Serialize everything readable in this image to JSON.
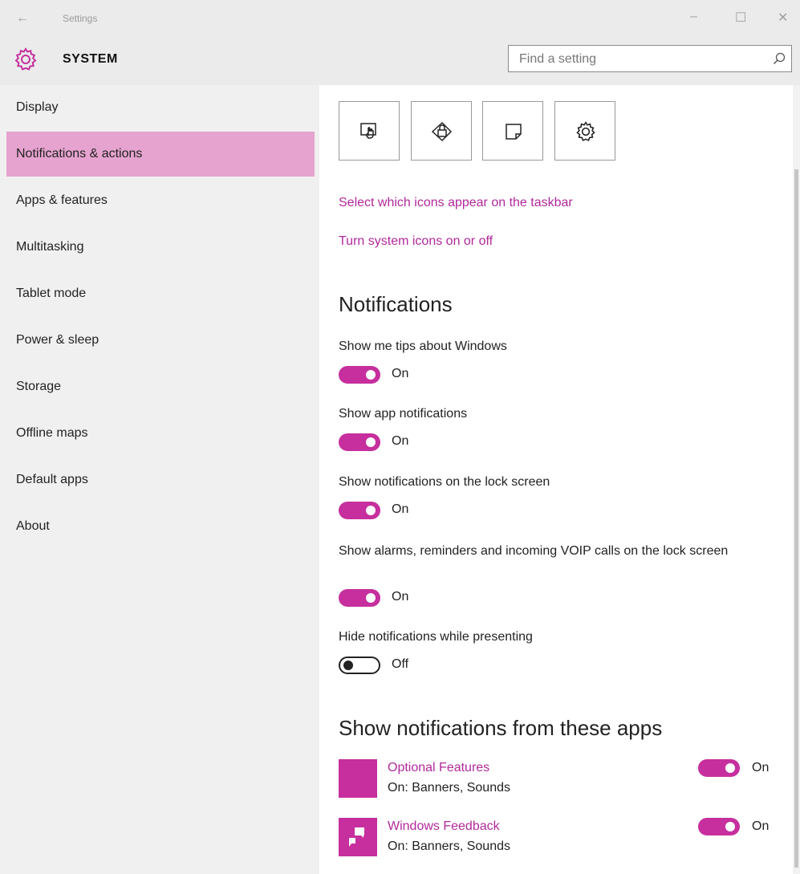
{
  "window": {
    "title": "Settings",
    "back_icon": "←",
    "minimize_icon": "–",
    "maximize_icon": "☐",
    "close_icon": "✕"
  },
  "header": {
    "title": "SYSTEM",
    "search_placeholder": "Find a setting"
  },
  "sidebar": {
    "items": [
      {
        "label": "Display"
      },
      {
        "label": "Notifications & actions",
        "selected": true
      },
      {
        "label": "Apps & features"
      },
      {
        "label": "Multitasking"
      },
      {
        "label": "Tablet mode"
      },
      {
        "label": "Power & sleep"
      },
      {
        "label": "Storage"
      },
      {
        "label": "Offline maps"
      },
      {
        "label": "Default apps"
      },
      {
        "label": "About"
      }
    ]
  },
  "quick_actions": [
    "tablet-mode-icon",
    "location-icon",
    "note-icon",
    "settings-icon"
  ],
  "links": {
    "taskbar_icons": "Select which icons appear on the taskbar",
    "system_icons": "Turn system icons on or off"
  },
  "notifications": {
    "heading": "Notifications",
    "settings": [
      {
        "label": "Show me tips about Windows",
        "state": "On"
      },
      {
        "label": "Show app notifications",
        "state": "On"
      },
      {
        "label": "Show notifications on the lock screen",
        "state": "On"
      },
      {
        "label": "Show alarms, reminders and incoming VOIP calls on the lock screen",
        "state": "On"
      },
      {
        "label": "Hide notifications while presenting",
        "state": "Off"
      }
    ]
  },
  "apps": {
    "heading": "Show notifications from these apps",
    "items": [
      {
        "name": "Optional Features",
        "status": "On: Banners, Sounds",
        "state": "On"
      },
      {
        "name": "Windows Feedback",
        "status": "On: Banners, Sounds",
        "state": "On"
      }
    ]
  },
  "colors": {
    "accent": "#c62f9d",
    "selected_nav": "#e6a3cf",
    "link": "#b1299b"
  }
}
